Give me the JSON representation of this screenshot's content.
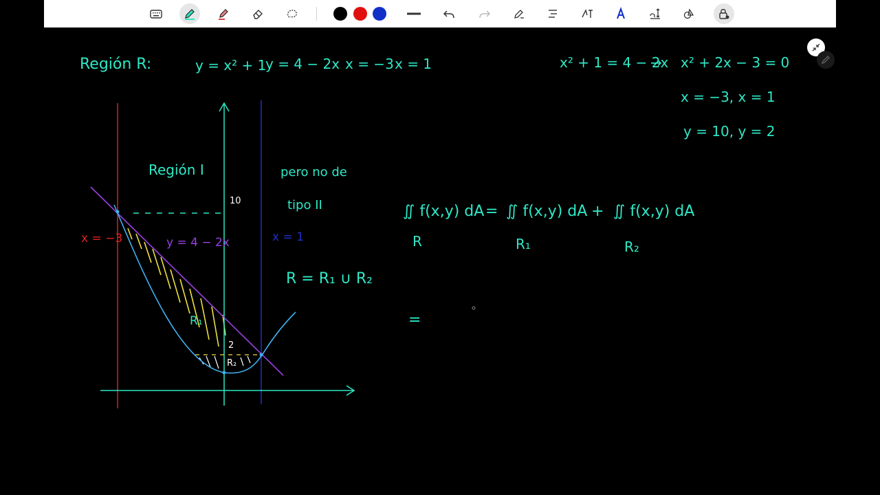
{
  "toolbar": {
    "tools": [
      {
        "name": "keyboard-icon"
      },
      {
        "name": "pen-icon",
        "active": true
      },
      {
        "name": "highlighter-icon"
      },
      {
        "name": "eraser-icon"
      },
      {
        "name": "lasso-icon"
      },
      {
        "name": "color-black",
        "color": "#000000"
      },
      {
        "name": "color-red",
        "color": "#e01010"
      },
      {
        "name": "color-blue",
        "color": "#1030c8"
      },
      {
        "name": "line-icon"
      },
      {
        "name": "undo-icon"
      },
      {
        "name": "redo-icon"
      },
      {
        "name": "ink-to-shape-icon"
      },
      {
        "name": "align-icon"
      },
      {
        "name": "ink-to-text-icon"
      },
      {
        "name": "font-a-icon"
      },
      {
        "name": "text-spacing-icon"
      },
      {
        "name": "shapes-icon"
      },
      {
        "name": "lock-icon"
      }
    ]
  },
  "colors": {
    "ink_cyan": "#2ee8c6",
    "ink_red": "#e02020",
    "ink_blue": "#2030c8",
    "ink_purple": "#9b40e0",
    "ink_yellow": "#f0e040",
    "ink_light_blue": "#40b0f0"
  },
  "notes": {
    "region_title": "Región R:",
    "curve1": "y = x² + 1",
    "curve2": "y = 4 − 2x",
    "bound1": "x = −3",
    "bound2": "x = 1",
    "intersection_eq": "x² + 1 = 4 − 2x",
    "arrow": "→",
    "quadratic": "x² + 2x − 3 = 0",
    "roots": "x = −3,  x = 1",
    "y_values": "y = 10,  y = 2",
    "region_type_1": "Región I",
    "not_type_2a": "pero no de",
    "not_type_2b": "tipo II",
    "union": "R = R₁ ∪ R₂",
    "integral_main": "∬ f(x,y) dA",
    "integral_sub": "R",
    "equals": "=",
    "integral_r1": "∬ f(x,y) dA",
    "integral_r1_sub": "R₁",
    "plus": "+",
    "integral_r2": "∬ f(x,y) dA",
    "integral_r2_sub": "R₂",
    "equals2": "="
  },
  "graph": {
    "label_x_neg3": "x = −3",
    "label_x_1": "x = 1",
    "label_line": "y = 4 − 2x",
    "label_10": "10",
    "label_2": "2",
    "label_r1": "R₁",
    "label_r2": "R₂"
  }
}
